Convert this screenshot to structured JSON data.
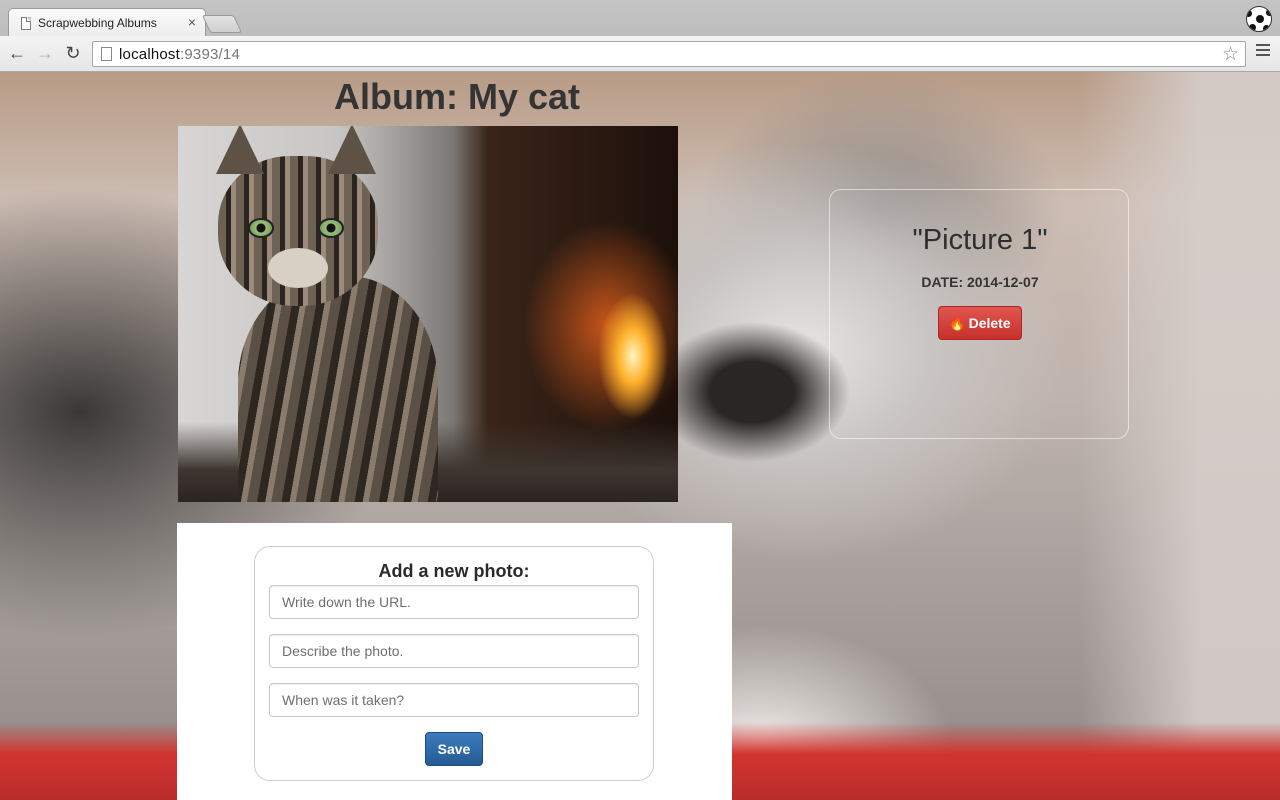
{
  "browser": {
    "tab": {
      "title": "Scrapwebbing Albums",
      "close_glyph": "×"
    },
    "address": {
      "host": "localhost",
      "rest": ":9393/14"
    },
    "icons": {
      "back": "back-arrow-icon",
      "forward": "forward-arrow-icon",
      "reload": "reload-icon",
      "star": "bookmark-star-icon",
      "menu": "hamburger-menu-icon",
      "profile": "soccer-ball-avatar"
    }
  },
  "album": {
    "title": "Album: My cat"
  },
  "picture": {
    "title": "\"Picture 1\"",
    "date_label": "DATE:",
    "date_value": "2014-12-07",
    "delete_label": "Delete",
    "delete_icon": "fire-icon"
  },
  "form": {
    "heading": "Add a new photo:",
    "url_placeholder": "Write down the URL.",
    "description_placeholder": "Describe the photo.",
    "date_placeholder": "When was it taken?",
    "save_label": "Save"
  },
  "colors": {
    "delete_button": "#d9534f",
    "save_button": "#2f6aa8",
    "title_text": "#343434"
  }
}
